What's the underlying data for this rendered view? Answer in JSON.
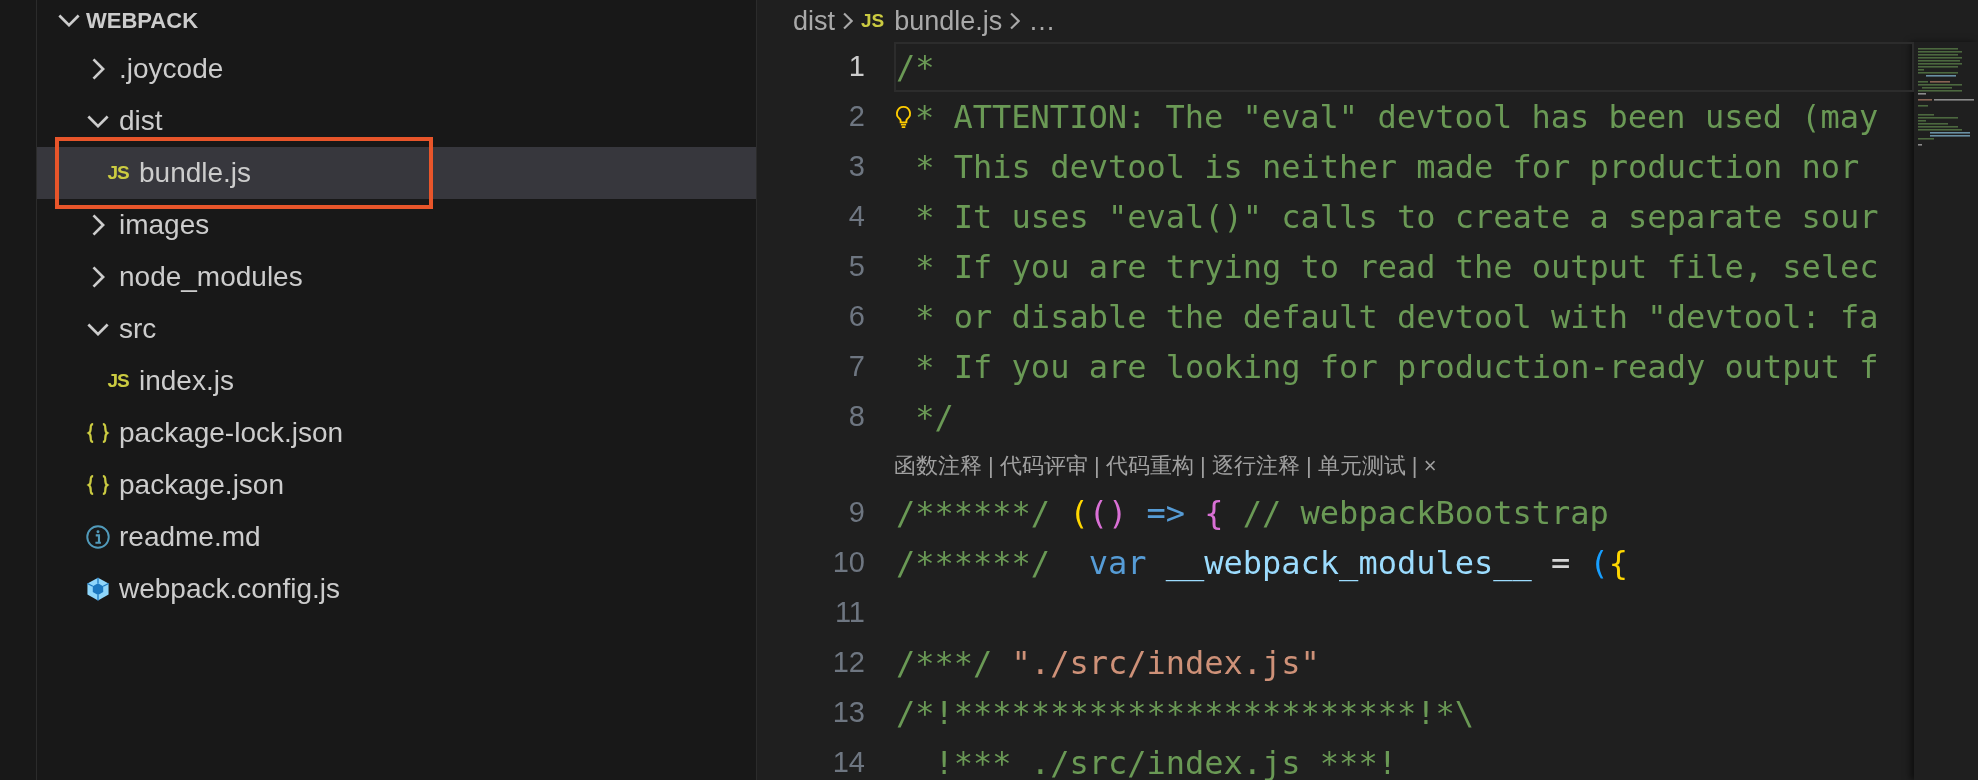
{
  "explorer": {
    "title": "WEBPACK",
    "expanded": true,
    "items": [
      {
        "name": ".joycode",
        "kind": "folder",
        "expanded": false,
        "selected": false
      },
      {
        "name": "dist",
        "kind": "folder",
        "expanded": true,
        "selected": false,
        "children": [
          {
            "name": "bundle.js",
            "kind": "js",
            "icon_label": "JS",
            "selected": true,
            "outlined": true
          }
        ]
      },
      {
        "name": "images",
        "kind": "folder",
        "expanded": false,
        "selected": false
      },
      {
        "name": "node_modules",
        "kind": "folder",
        "expanded": false,
        "selected": false
      },
      {
        "name": "src",
        "kind": "folder",
        "expanded": true,
        "selected": false,
        "children": [
          {
            "name": "index.js",
            "kind": "js",
            "icon_label": "JS",
            "selected": false
          }
        ]
      },
      {
        "name": "package-lock.json",
        "kind": "json",
        "selected": false
      },
      {
        "name": "package.json",
        "kind": "json",
        "selected": false
      },
      {
        "name": "readme.md",
        "kind": "info",
        "selected": false
      },
      {
        "name": "webpack.config.js",
        "kind": "config",
        "selected": false
      }
    ]
  },
  "breadcrumb": {
    "folder": "dist",
    "file": "bundle.js",
    "file_icon_label": "JS",
    "more": "…"
  },
  "editor": {
    "lines": [
      {
        "kind": "code",
        "number": "1",
        "current": true,
        "lightbulb": false,
        "tokens": [
          {
            "kind": "comment",
            "text": "/*"
          }
        ]
      },
      {
        "kind": "code",
        "number": "2",
        "current": false,
        "lightbulb": true,
        "tokens": [
          {
            "kind": "comment",
            "text": "* ATTENTION: The \"eval\" devtool has been used (may"
          }
        ]
      },
      {
        "kind": "code",
        "number": "3",
        "current": false,
        "lightbulb": false,
        "tokens": [
          {
            "kind": "comment",
            "text": " * This devtool is neither made for production nor"
          }
        ]
      },
      {
        "kind": "code",
        "number": "4",
        "current": false,
        "lightbulb": false,
        "tokens": [
          {
            "kind": "comment",
            "text": " * It uses \"eval()\" calls to create a separate sour"
          }
        ]
      },
      {
        "kind": "code",
        "number": "5",
        "current": false,
        "lightbulb": false,
        "tokens": [
          {
            "kind": "comment",
            "text": " * If you are trying to read the output file, selec"
          }
        ]
      },
      {
        "kind": "code",
        "number": "6",
        "current": false,
        "lightbulb": false,
        "tokens": [
          {
            "kind": "comment",
            "text": " * or disable the default devtool with \"devtool: fa"
          }
        ]
      },
      {
        "kind": "code",
        "number": "7",
        "current": false,
        "lightbulb": false,
        "tokens": [
          {
            "kind": "comment",
            "text": " * If you are looking for production-ready output f"
          }
        ]
      },
      {
        "kind": "code",
        "number": "8",
        "current": false,
        "lightbulb": false,
        "tokens": [
          {
            "kind": "comment",
            "text": " */"
          }
        ]
      },
      {
        "kind": "codelens",
        "text": "函数注释 | 代码评审 | 代码重构 | 逐行注释 | 单元测试 | ×"
      },
      {
        "kind": "code",
        "number": "9",
        "current": false,
        "lightbulb": false,
        "tokens": [
          {
            "kind": "comment",
            "text": "/******/"
          },
          {
            "kind": "bracket1",
            "text": " ("
          },
          {
            "kind": "bracket2",
            "text": "()"
          },
          {
            "kind": "keyword",
            "text": " =>"
          },
          {
            "kind": "bracket2",
            "text": " {"
          },
          {
            "kind": "comment",
            "text": " // webpackBootstrap"
          }
        ]
      },
      {
        "kind": "code",
        "number": "10",
        "current": false,
        "lightbulb": false,
        "tokens": [
          {
            "kind": "comment",
            "text": "/******/"
          },
          {
            "kind": "keyword",
            "text": "  var"
          },
          {
            "kind": "variable",
            "text": " __webpack_modules__"
          },
          {
            "kind": "operator",
            "text": " ="
          },
          {
            "kind": "bracket3",
            "text": " ("
          },
          {
            "kind": "bracket1",
            "text": "{"
          }
        ]
      },
      {
        "kind": "code",
        "number": "11",
        "current": false
      },
      {
        "kind": "code",
        "number": "12",
        "current": false,
        "lightbulb": false,
        "tokens": [
          {
            "kind": "comment",
            "text": "/***/"
          },
          {
            "kind": "string",
            "text": " \"./src/index.js\""
          }
        ]
      },
      {
        "kind": "code",
        "number": "13",
        "current": false,
        "lightbulb": false,
        "tokens": [
          {
            "kind": "comment",
            "text": "/*!************************!*\\"
          }
        ]
      },
      {
        "kind": "code",
        "number": "14",
        "current": false,
        "lightbulb": false,
        "tokens": [
          {
            "kind": "comment",
            "text": "  !*** ./src/index.js ***!"
          }
        ]
      }
    ]
  }
}
